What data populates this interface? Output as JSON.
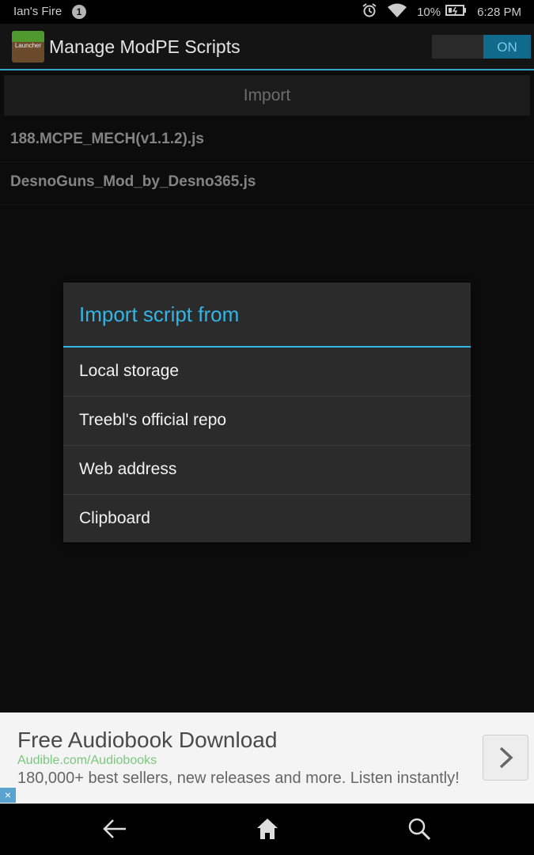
{
  "status_bar": {
    "device_name": "Ian's Fire",
    "notification_count": "1",
    "battery_percent": "10%",
    "time": "6:28 PM"
  },
  "action_bar": {
    "app_icon_text": "Launcher",
    "title": "Manage ModPE Scripts",
    "toggle_label": "ON"
  },
  "main": {
    "import_button_label": "Import",
    "scripts": [
      "188.MCPE_MECH(v1.1.2).js",
      "DesnoGuns_Mod_by_Desno365.js"
    ]
  },
  "dialog": {
    "title": "Import script from",
    "options": [
      "Local storage",
      "Treebl's official repo",
      "Web address",
      "Clipboard"
    ]
  },
  "ad": {
    "title": "Free Audiobook Download",
    "url": "Audible.com/Audiobooks",
    "description": "180,000+ best sellers, new releases and more. Listen instantly!",
    "close_label": "×"
  },
  "icons": [
    "alarm-icon",
    "wifi-icon",
    "battery-icon",
    "chevron-right-icon",
    "back-icon",
    "home-icon",
    "search-icon"
  ],
  "colors": {
    "accent": "#33b5e5",
    "toggle_on": "#0f6a8c",
    "ad_url": "#7bc77d"
  }
}
